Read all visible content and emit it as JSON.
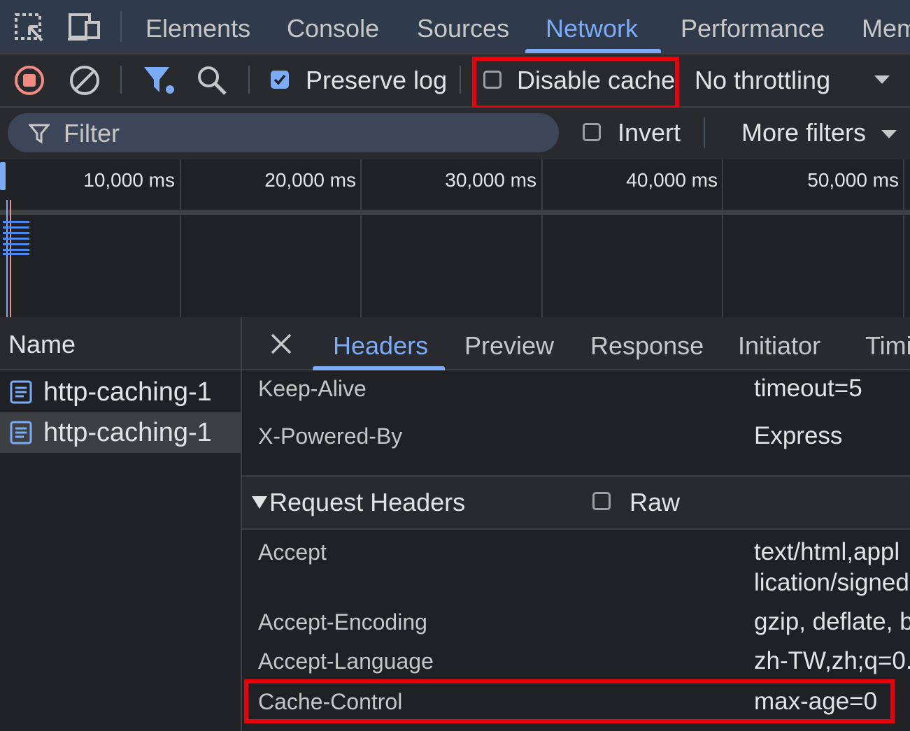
{
  "tabs": {
    "items": [
      "Elements",
      "Console",
      "Sources",
      "Network",
      "Performance",
      "Mem"
    ],
    "active": "Network"
  },
  "toolbar": {
    "preserve_log": "Preserve log",
    "disable_cache": "Disable cache",
    "throttling": "No throttling"
  },
  "filter": {
    "placeholder": "Filter",
    "invert": "Invert",
    "more_filters": "More filters"
  },
  "timeline": {
    "ticks": [
      "10,000 ms",
      "20,000 ms",
      "30,000 ms",
      "40,000 ms",
      "50,000 ms"
    ]
  },
  "requests": {
    "header": "Name",
    "items": [
      "http-caching-1",
      "http-caching-1"
    ]
  },
  "detail": {
    "tabs": [
      "Headers",
      "Preview",
      "Response",
      "Initiator",
      "Timi"
    ],
    "response_headers": [
      {
        "name": "Keep-Alive",
        "value": "timeout=5"
      },
      {
        "name": "X-Powered-By",
        "value": "Express"
      }
    ],
    "request_section": {
      "title": "Request Headers",
      "raw": "Raw"
    },
    "request_headers": [
      {
        "name": "Accept",
        "value": "text/html,appl",
        "value2": "lication/signed"
      },
      {
        "name": "Accept-Encoding",
        "value": "gzip, deflate, b"
      },
      {
        "name": "Accept-Language",
        "value": "zh-TW,zh;q=0."
      },
      {
        "name": "Cache-Control",
        "value": "max-age=0"
      }
    ]
  },
  "colors": {
    "accent": "#7cacf8",
    "highlight_box": "#e8000b",
    "record_red": "#f28b82"
  }
}
